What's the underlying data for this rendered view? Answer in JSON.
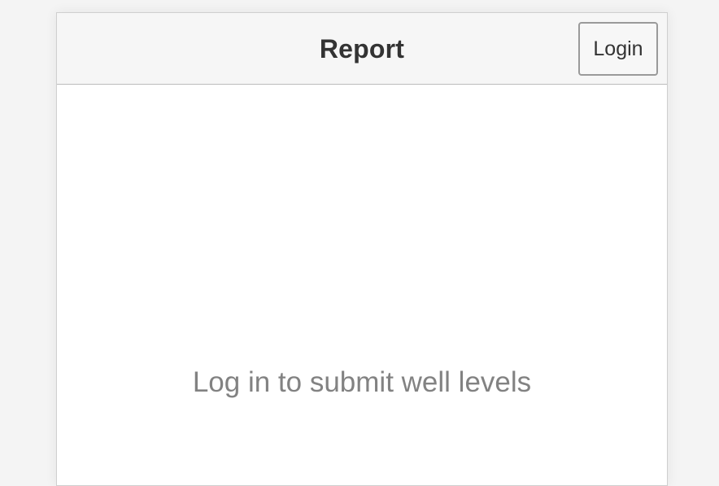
{
  "header": {
    "title": "Report",
    "login_label": "Login"
  },
  "content": {
    "message": "Log in to submit well levels"
  },
  "colors": {
    "header_background": "#f6f6f6",
    "page_background": "#f4f4f4",
    "message_text": "#828282"
  }
}
